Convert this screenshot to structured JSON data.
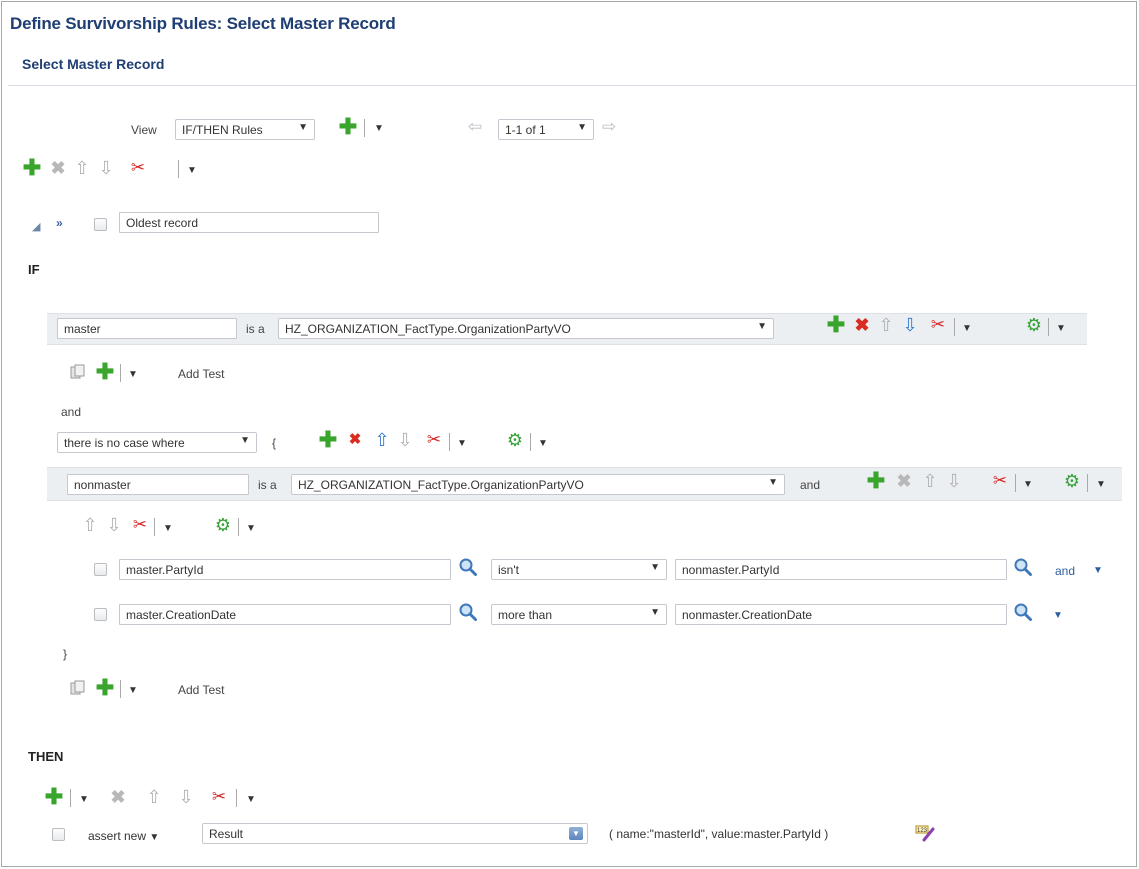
{
  "page": {
    "title": "Define Survivorship Rules: Select Master Record",
    "subtitle": "Select Master Record"
  },
  "view_bar": {
    "view_label": "View",
    "view_value": "IF/THEN Rules",
    "pager_value": "1-1 of 1"
  },
  "rule": {
    "name": "Oldest record",
    "if_label": "IF",
    "then_label": "THEN"
  },
  "fact1": {
    "variable": "master",
    "is_a": "is a",
    "type": "HZ_ORGANIZATION_FactType.OrganizationPartyVO"
  },
  "add_test": "Add Test",
  "and_label": "and",
  "quantifier": {
    "value": "there is no case where",
    "open_brace": "{",
    "close_brace": "}"
  },
  "fact2": {
    "variable": "nonmaster",
    "is_a": "is a",
    "type": "HZ_ORGANIZATION_FactType.OrganizationPartyVO",
    "and": "and"
  },
  "tests": [
    {
      "left": "master.PartyId",
      "op": "isn't",
      "right": "nonmaster.PartyId",
      "connector": "and"
    },
    {
      "left": "master.CreationDate",
      "op": "more than",
      "right": "nonmaster.CreationDate",
      "connector": ""
    }
  ],
  "action": {
    "verb": "assert new",
    "target": "Result",
    "params": "( name:\"masterId\", value:master.PartyId )"
  },
  "icons": {
    "plus": "add-icon",
    "delete": "delete-icon",
    "up": "move-up-icon",
    "down": "move-down-icon",
    "cut": "cut-icon",
    "gear": "gear-icon",
    "search": "search-icon",
    "copy": "copy-icon"
  },
  "colors": {
    "title": "#1f3e73",
    "add": "#3aa52c",
    "delete": "#d92b1f",
    "bar": "#eceff2"
  }
}
